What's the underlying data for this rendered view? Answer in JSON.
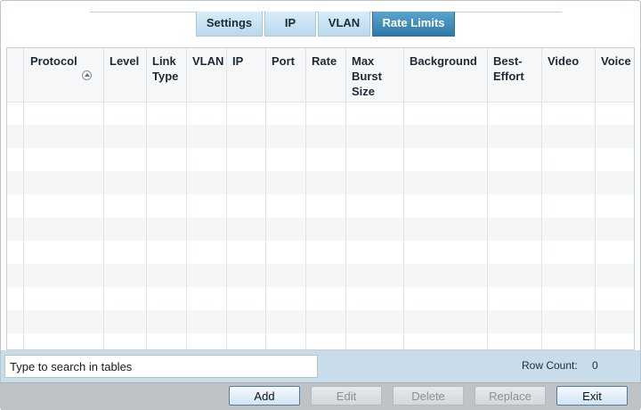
{
  "tabs": [
    {
      "label": "Settings",
      "active": false
    },
    {
      "label": "IP",
      "active": false
    },
    {
      "label": "VLAN",
      "active": false
    },
    {
      "label": "Rate Limits",
      "active": true
    }
  ],
  "table": {
    "columns": [
      "Protocol",
      "Level",
      "Link Type",
      "VLAN",
      "IP",
      "Port",
      "Rate",
      "Max Burst Size",
      "Background",
      "Best-Effort",
      "Video",
      "Voice"
    ],
    "header_lines": {
      "link_type": [
        "Link",
        "Type"
      ],
      "max_burst_size": [
        "Max",
        "Burst",
        "Size"
      ],
      "best_effort": [
        "Best-",
        "Effort"
      ]
    },
    "sort_column": "Protocol",
    "sort_direction": "ascending",
    "rows": []
  },
  "search": {
    "placeholder": "Type to search in tables",
    "value": ""
  },
  "row_count": {
    "label": "Row Count:",
    "value": "0"
  },
  "buttons": {
    "add": {
      "label": "Add",
      "enabled": true
    },
    "edit": {
      "label": "Edit",
      "enabled": false
    },
    "delete": {
      "label": "Delete",
      "enabled": false
    },
    "replace": {
      "label": "Replace",
      "enabled": false
    },
    "exit": {
      "label": "Exit",
      "enabled": true
    }
  },
  "colors": {
    "active_tab": "#3a85b6",
    "footer_bg": "#c9dcea",
    "buttonbar_bg": "#bfc3c6"
  }
}
